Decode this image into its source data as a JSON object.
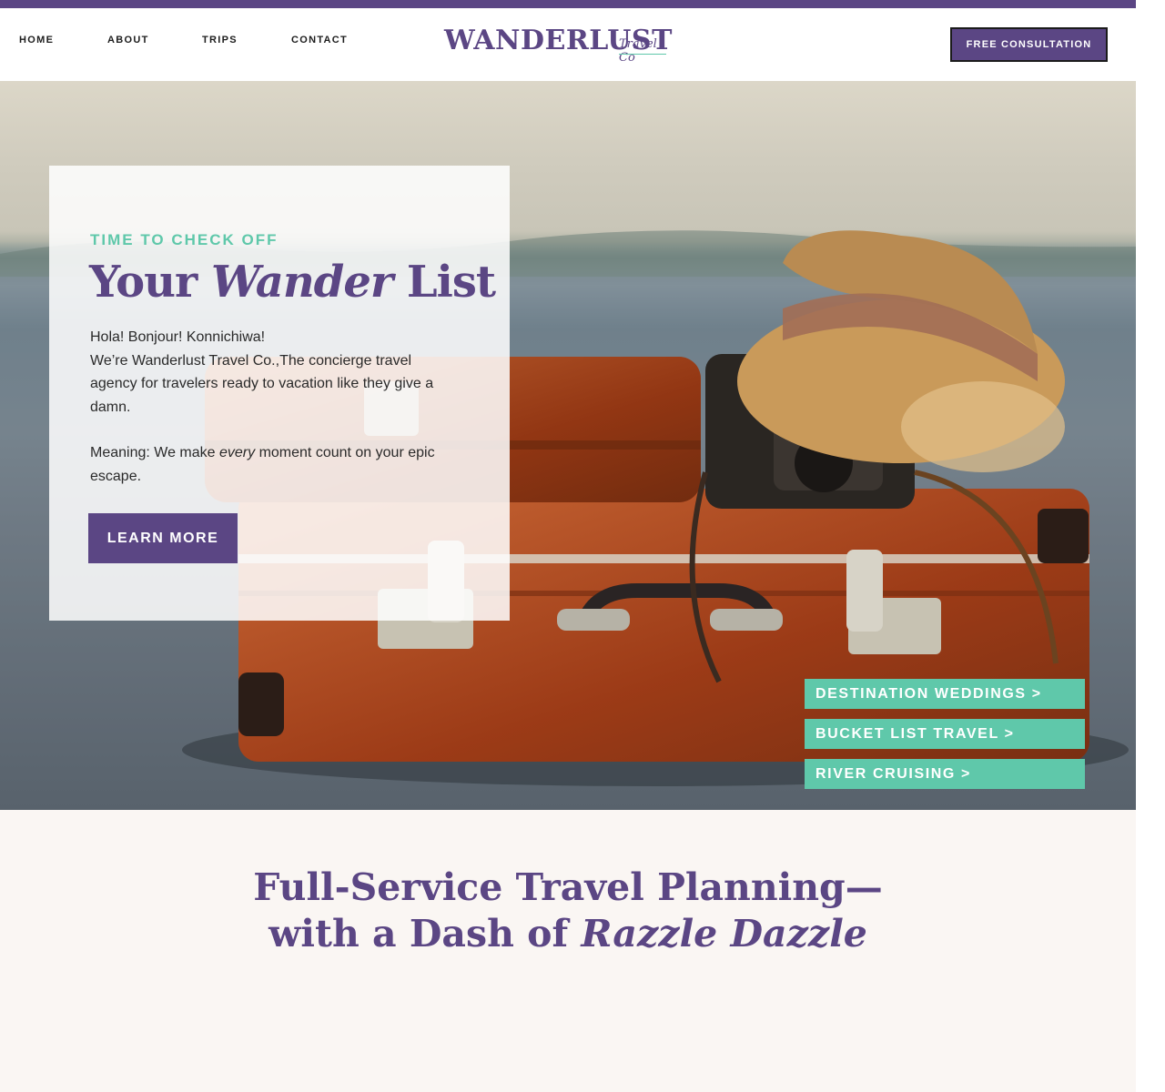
{
  "colors": {
    "brand_purple": "#5b4684",
    "accent_teal": "#5fc8aa",
    "section_bg": "#faf6f3"
  },
  "nav": {
    "items": [
      {
        "label": "HOME"
      },
      {
        "label": "ABOUT"
      },
      {
        "label": "TRIPS"
      },
      {
        "label": "CONTACT"
      }
    ],
    "logo": {
      "main": "WANDERLUST",
      "sub": "Travel Co"
    },
    "cta": "FREE CONSULTATION"
  },
  "hero": {
    "kicker": "TIME TO CHECK OFF",
    "headline": {
      "before": "Your",
      "emphasis": "Wander",
      "after": "List"
    },
    "paragraph1_line1": "Hola! Bonjour! Konnichiwa!",
    "paragraph1_line2": "We’re Wanderlust Travel Co.,The concierge travel agency for travelers ready to vacation like they give a damn.",
    "paragraph2": {
      "before": "Meaning: We make ",
      "emphasis": "every",
      "after": " moment count on your epic escape."
    },
    "button": "LEARN MORE",
    "quick_links": [
      {
        "label": "DESTINATION WEDDINGS >"
      },
      {
        "label": "BUCKET LIST TRAVEL >"
      },
      {
        "label": "RIVER CRUISING >"
      }
    ]
  },
  "section": {
    "title_line1": "Full-Service Travel Planning—",
    "title_line2_before": "with a Dash of ",
    "title_line2_emphasis": "Razzle Dazzle"
  }
}
